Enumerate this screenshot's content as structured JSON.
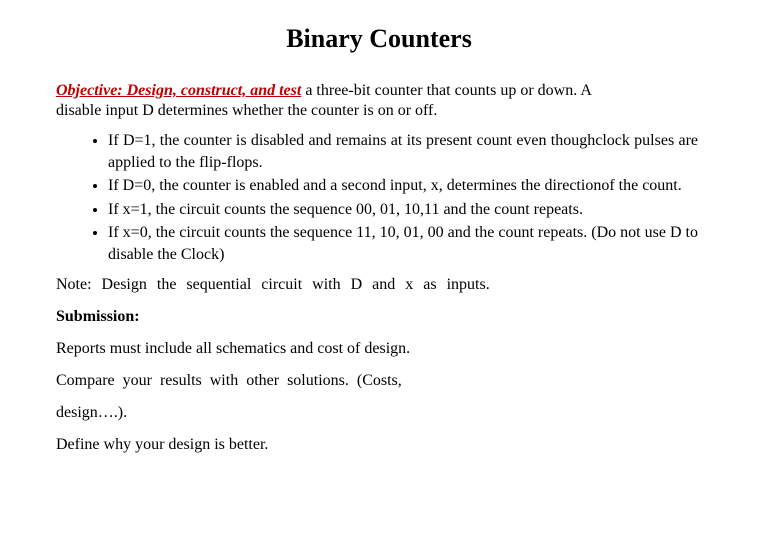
{
  "title": "Binary Counters",
  "objective": {
    "lead": "Objective: Design, construct, and test",
    "tail": " a three-bit counter that counts up or down. A",
    "line2": "disable input D determines whether the counter is on or off."
  },
  "bullets": [
    "If D=1, the counter is disabled and remains at its present count even thoughclock pulses are applied to the flip-flops.",
    "If D=0, the counter is enabled and a second input, x, determines the directionof the count.",
    "If x=1, the circuit counts the sequence 00, 01, 10,11 and the count repeats.",
    "If x=0, the circuit counts the sequence 11, 10, 01, 00 and the count repeats. (Do not use D to disable the Clock)"
  ],
  "note": "Note: Design the sequential circuit with D and x as inputs.",
  "submission_heading": "Submission:",
  "sub1": "Reports must include all schematics and cost of design.",
  "sub2": "Compare your results with other solutions. (Costs,",
  "sub3": "design….).",
  "sub4": "Define why your design is better."
}
